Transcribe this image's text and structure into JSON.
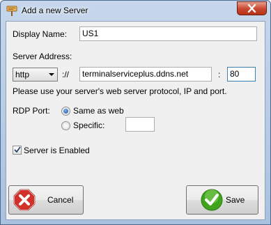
{
  "window": {
    "title": "Add a new Server"
  },
  "form": {
    "display_name_label": "Display Name:",
    "display_name_value": "US1",
    "server_address_label": "Server Address:",
    "protocol_selected": "http",
    "scheme_separator": "://",
    "host_value": "terminalserviceplus.ddns.net",
    "port_separator": ":",
    "port_value": "80",
    "hint": "Please use your server's web server protocol, IP and port.",
    "rdp_port_label": "RDP Port:",
    "rdp_option_same": "Same as web",
    "rdp_option_specific": "Specific:",
    "rdp_option_same_selected": true,
    "specific_port_value": "",
    "enabled_label": "Server is Enabled",
    "enabled_checked": true
  },
  "buttons": {
    "cancel_label": "Cancel",
    "save_label": "Save"
  },
  "icons": {
    "title": "server-sign-icon",
    "close": "close-icon",
    "cancel": "stop-x-icon",
    "save": "checkmark-icon",
    "dropdown": "chevron-down-icon"
  },
  "colors": {
    "cancel_red": "#d2312a",
    "save_green": "#3ea41c",
    "selection_blue": "#1a4f9e"
  }
}
